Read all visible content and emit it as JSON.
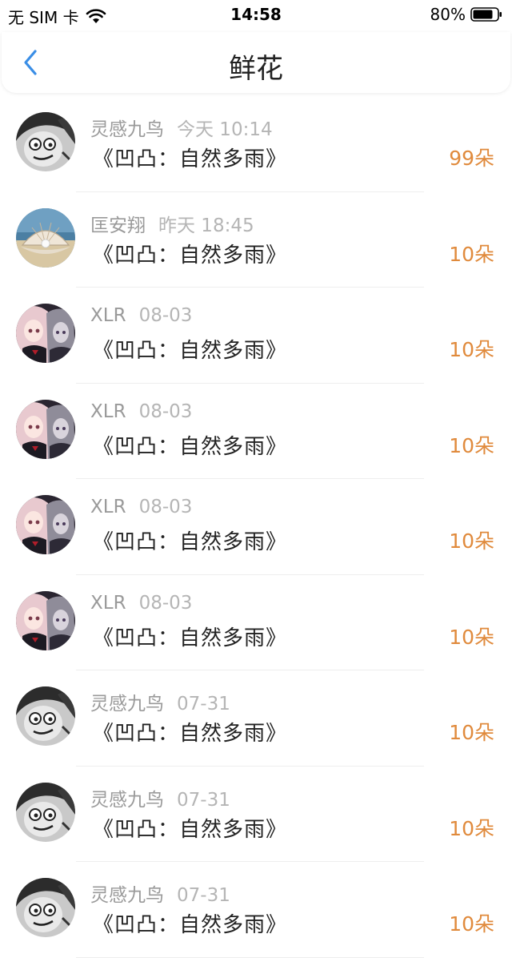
{
  "status_bar": {
    "carrier": "无 SIM 卡",
    "time": "14:58",
    "battery": "80%"
  },
  "nav": {
    "title": "鲜花"
  },
  "colors": {
    "accent_blue": "#3a8ee6",
    "flower_orange": "#e08a3c"
  },
  "items": [
    {
      "user": "灵感九鸟",
      "time": "今天 10:14",
      "book": "《凹凸：自然多雨》",
      "flowers": "99朵",
      "avatar": "sketch-face"
    },
    {
      "user": "匡安翔",
      "time": "昨天 18:45",
      "book": "《凹凸：自然多雨》",
      "flowers": "10朵",
      "avatar": "shell-pearl"
    },
    {
      "user": "XLR",
      "time": "08-03",
      "book": "《凹凸：自然多雨》",
      "flowers": "10朵",
      "avatar": "anime-girls"
    },
    {
      "user": "XLR",
      "time": "08-03",
      "book": "《凹凸：自然多雨》",
      "flowers": "10朵",
      "avatar": "anime-girls"
    },
    {
      "user": "XLR",
      "time": "08-03",
      "book": "《凹凸：自然多雨》",
      "flowers": "10朵",
      "avatar": "anime-girls"
    },
    {
      "user": "XLR",
      "time": "08-03",
      "book": "《凹凸：自然多雨》",
      "flowers": "10朵",
      "avatar": "anime-girls"
    },
    {
      "user": "灵感九鸟",
      "time": "07-31",
      "book": "《凹凸：自然多雨》",
      "flowers": "10朵",
      "avatar": "sketch-face"
    },
    {
      "user": "灵感九鸟",
      "time": "07-31",
      "book": "《凹凸：自然多雨》",
      "flowers": "10朵",
      "avatar": "sketch-face"
    },
    {
      "user": "灵感九鸟",
      "time": "07-31",
      "book": "《凹凸：自然多雨》",
      "flowers": "10朵",
      "avatar": "sketch-face"
    }
  ]
}
